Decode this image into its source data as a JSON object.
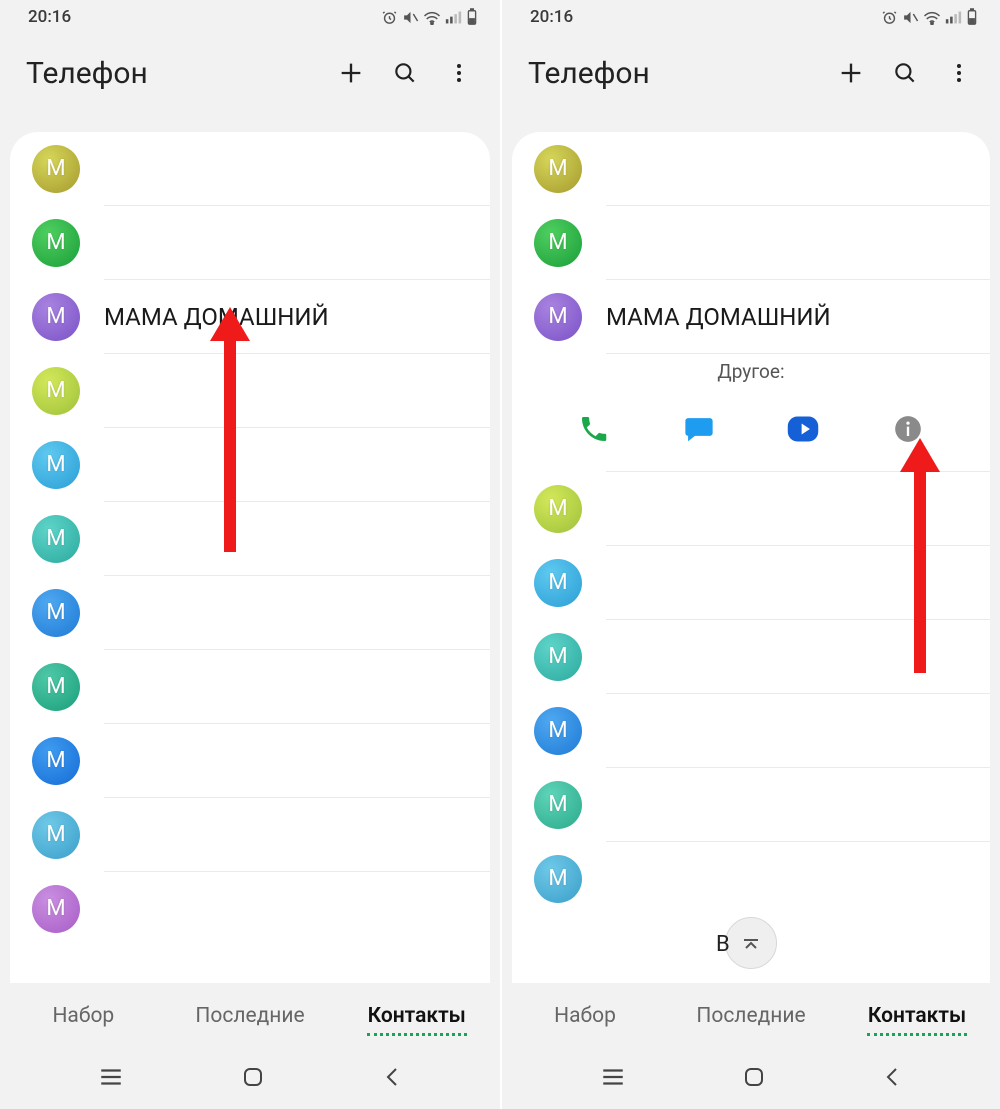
{
  "status": {
    "time": "20:16"
  },
  "header": {
    "title": "Телефон"
  },
  "contacts_left": [
    {
      "letter": "M",
      "name": "",
      "grad": "g-olive"
    },
    {
      "letter": "M",
      "name": "",
      "grad": "g-green"
    },
    {
      "letter": "M",
      "name": "МАМА ДОМАШНИЙ",
      "grad": "g-purple"
    },
    {
      "letter": "M",
      "name": "",
      "grad": "g-lime"
    },
    {
      "letter": "M",
      "name": "",
      "grad": "g-sky"
    },
    {
      "letter": "M",
      "name": "",
      "grad": "g-teal"
    },
    {
      "letter": "M",
      "name": "",
      "grad": "g-blue"
    },
    {
      "letter": "M",
      "name": "",
      "grad": "g-teal2"
    },
    {
      "letter": "M",
      "name": "",
      "grad": "g-blue2"
    },
    {
      "letter": "M",
      "name": "",
      "grad": "g-cyan"
    },
    {
      "letter": "M",
      "name": "",
      "grad": "g-violet"
    }
  ],
  "contacts_right_top": [
    {
      "letter": "M",
      "name": "",
      "grad": "g-olive"
    },
    {
      "letter": "M",
      "name": "",
      "grad": "g-green"
    },
    {
      "letter": "M",
      "name": "МАМА ДОМАШНИЙ",
      "grad": "g-purple"
    }
  ],
  "expanded": {
    "label": "Другое:"
  },
  "contacts_right_bottom": [
    {
      "letter": "M",
      "name": "",
      "grad": "g-lime"
    },
    {
      "letter": "M",
      "name": "",
      "grad": "g-sky"
    },
    {
      "letter": "M",
      "name": "",
      "grad": "g-teal"
    },
    {
      "letter": "M",
      "name": "",
      "grad": "g-blue"
    },
    {
      "letter": "M",
      "name": "",
      "grad": "g-turq"
    },
    {
      "letter": "M",
      "name": "",
      "grad": "g-cyan"
    }
  ],
  "fab_partial_text": "В",
  "tabs": {
    "dial": "Набор",
    "recent": "Последние",
    "contacts": "Контакты"
  }
}
